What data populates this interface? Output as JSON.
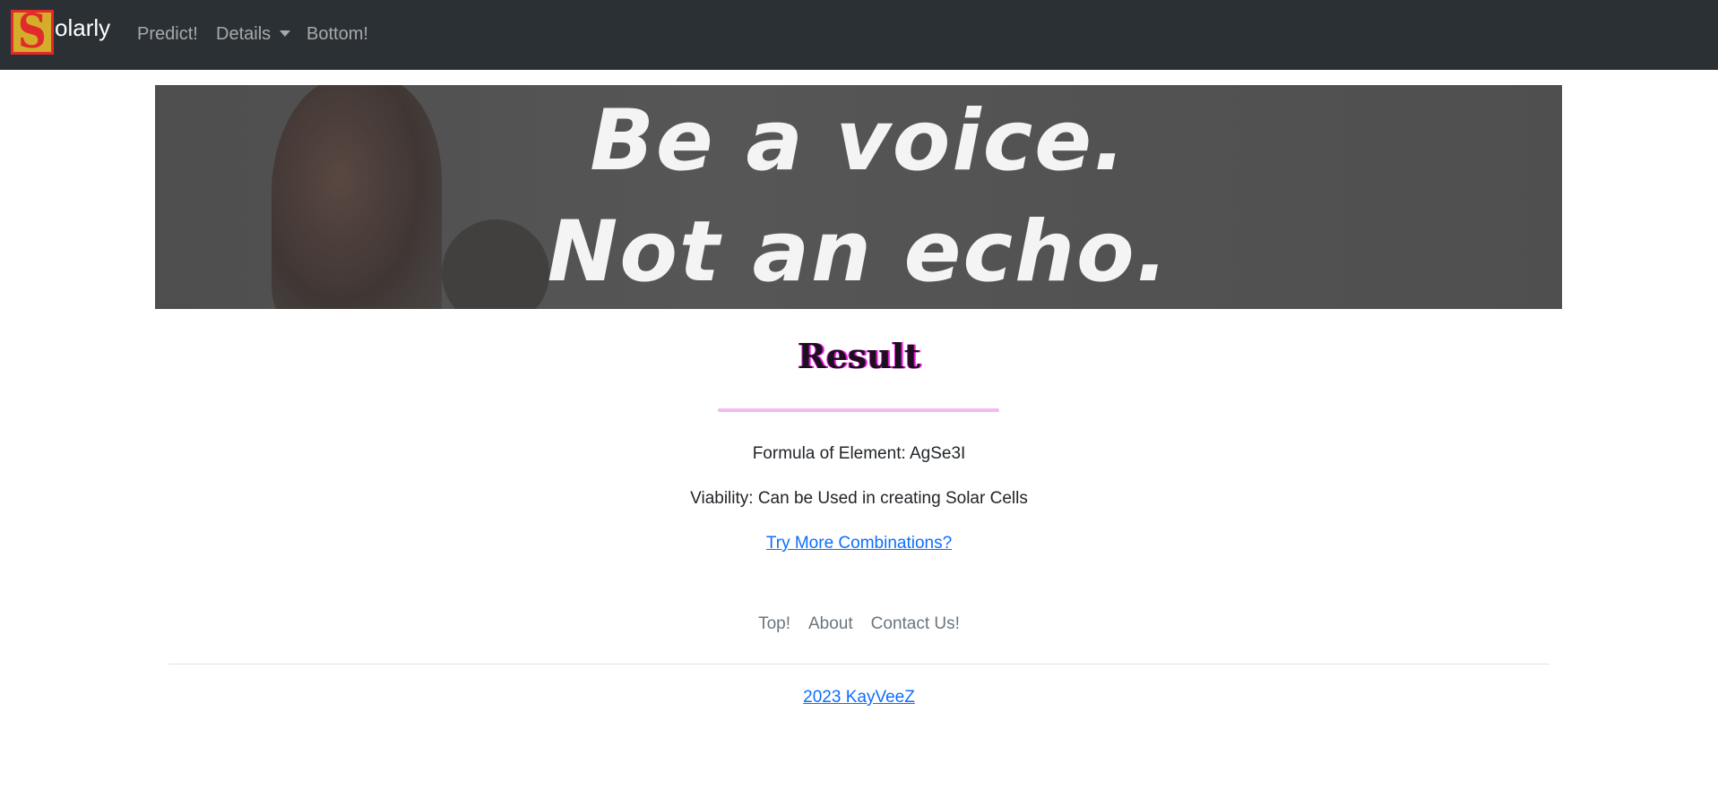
{
  "navbar": {
    "brand_letter": "S",
    "brand_text": "olarly",
    "links": [
      "Predict!",
      "Details",
      "Bottom!"
    ]
  },
  "banner": {
    "line1": "Be a voice.",
    "line2": "Not an echo."
  },
  "result": {
    "title": "Result",
    "formula": "Formula of Element: AgSe3I",
    "viability": "Viability: Can be Used in creating Solar Cells",
    "more_link": "Try More Combinations?"
  },
  "footer": {
    "links": [
      "Top!",
      "About",
      "Contact Us!"
    ],
    "copyright": "2023 KayVeeZ"
  },
  "colors": {
    "navbar_bg": "#2b3035",
    "title_accent": "#e81ae0",
    "link": "#0d6efd"
  }
}
